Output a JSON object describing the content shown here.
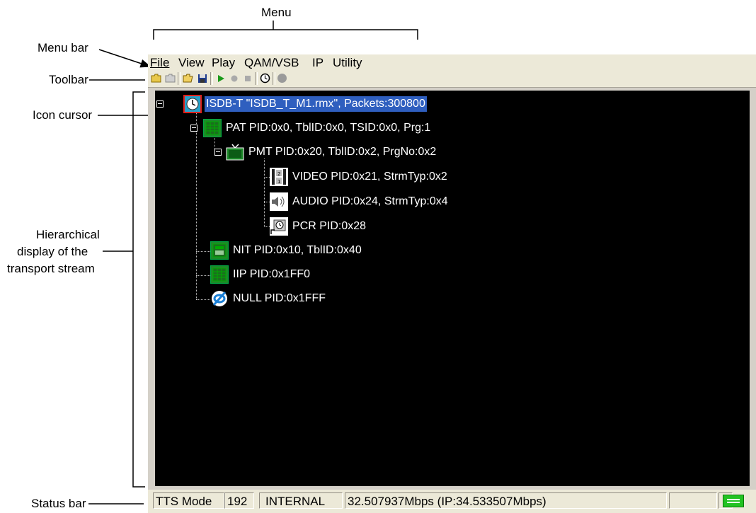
{
  "annotations": {
    "menu": "Menu",
    "menu_bar": "Menu bar",
    "toolbar": "Toolbar",
    "icon_cursor": "Icon cursor",
    "hierarchical_1": "Hierarchical",
    "hierarchical_2": "display of the",
    "hierarchical_3": "transport stream",
    "status_bar": "Status bar"
  },
  "menubar": {
    "file": "File",
    "view": "View",
    "play": "Play",
    "qam_vsb": "QAM/VSB",
    "ip": "IP",
    "utility": "Utility"
  },
  "toolbar": {
    "buttons": [
      "new-folder-icon",
      "folder-icon",
      "open-icon",
      "save-icon",
      "play-icon",
      "record-icon",
      "stop-icon",
      "clock-icon",
      "circle-icon"
    ]
  },
  "tree": {
    "root": "ISDB-T \"ISDB_T_M1.rmx\", Packets:300800",
    "pat": "PAT PID:0x0, TblID:0x0, TSID:0x0, Prg:1",
    "pmt": "PMT PID:0x20, TblID:0x2, PrgNo:0x2",
    "video": "VIDEO PID:0x21, StrmTyp:0x2",
    "audio": "AUDIO PID:0x24, StrmTyp:0x4",
    "pcr": "PCR PID:0x28",
    "nit": "NIT PID:0x10, TblID:0x40",
    "iip": "IIP PID:0x1FF0",
    "null": "NULL PID:0x1FFF"
  },
  "statusbar": {
    "mode": "TTS Mode",
    "packet_size": "192",
    "clock": "INTERNAL",
    "rate": "32.507937Mbps (IP:34.533507Mbps)"
  },
  "colors": {
    "selection": "#2f5fbf",
    "play_green": "#1a9a1a",
    "led_green": "#22c322"
  }
}
